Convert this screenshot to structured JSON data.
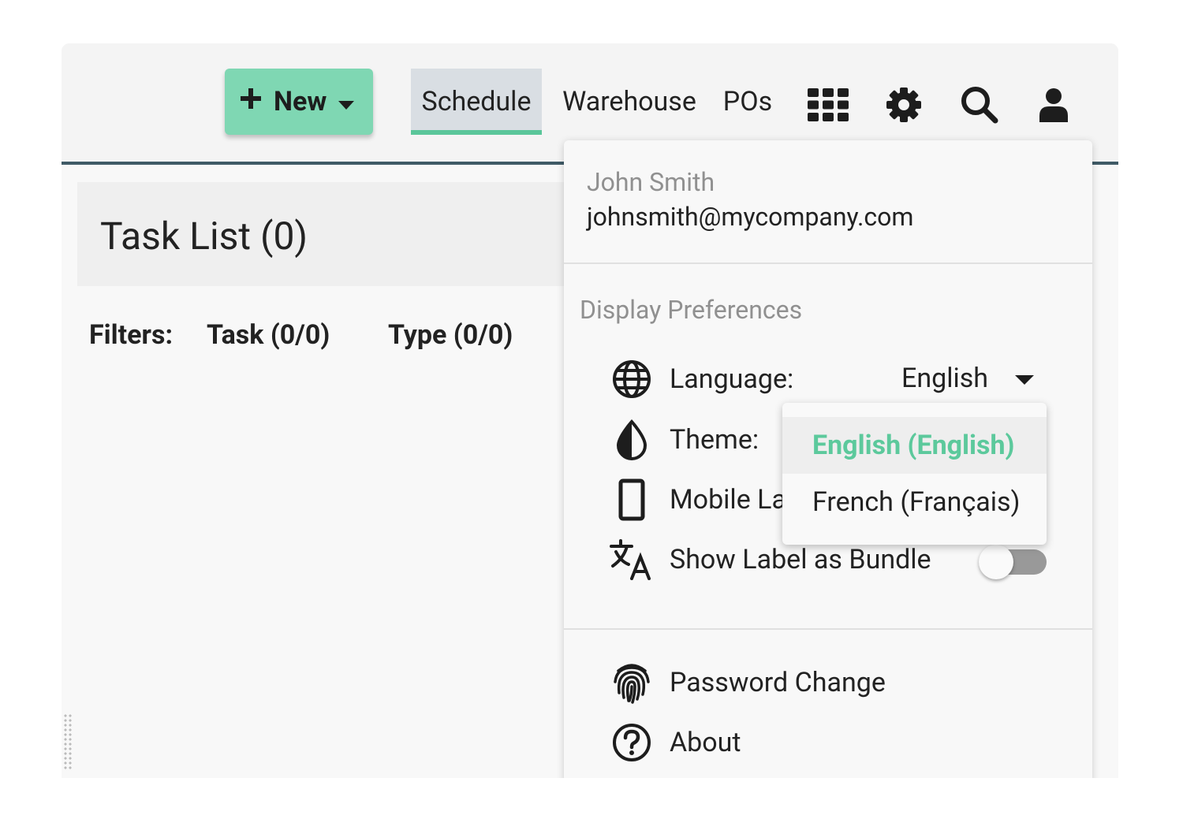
{
  "toolbar": {
    "new_label": "New",
    "tabs": [
      "Schedule",
      "Warehouse",
      "POs"
    ],
    "active_tab": "Schedule",
    "icons": [
      "apps-grid-icon",
      "gear-icon",
      "search-icon",
      "user-icon"
    ]
  },
  "task_list": {
    "title": "Task List (0)",
    "filters_label": "Filters:",
    "filter_task": "Task (0/0)",
    "filter_type": "Type (0/0)"
  },
  "user_menu": {
    "name": "John Smith",
    "email": "johnsmith@mycompany.com",
    "section_label": "Display Preferences",
    "language_label": "Language:",
    "language_value": "English",
    "theme_label": "Theme:",
    "mobile_label": "Mobile La",
    "bundle_label": "Show Label as Bundle",
    "bundle_toggle": "off",
    "password_label": "Password Change",
    "about_label": "About"
  },
  "language_dropdown": {
    "options": [
      "English (English)",
      "French (Français)"
    ],
    "selected": "English (English)"
  },
  "colors": {
    "accent_green": "#7fd7b3",
    "selected_text": "#5cc99c",
    "topbar_border": "#3f5a66"
  }
}
